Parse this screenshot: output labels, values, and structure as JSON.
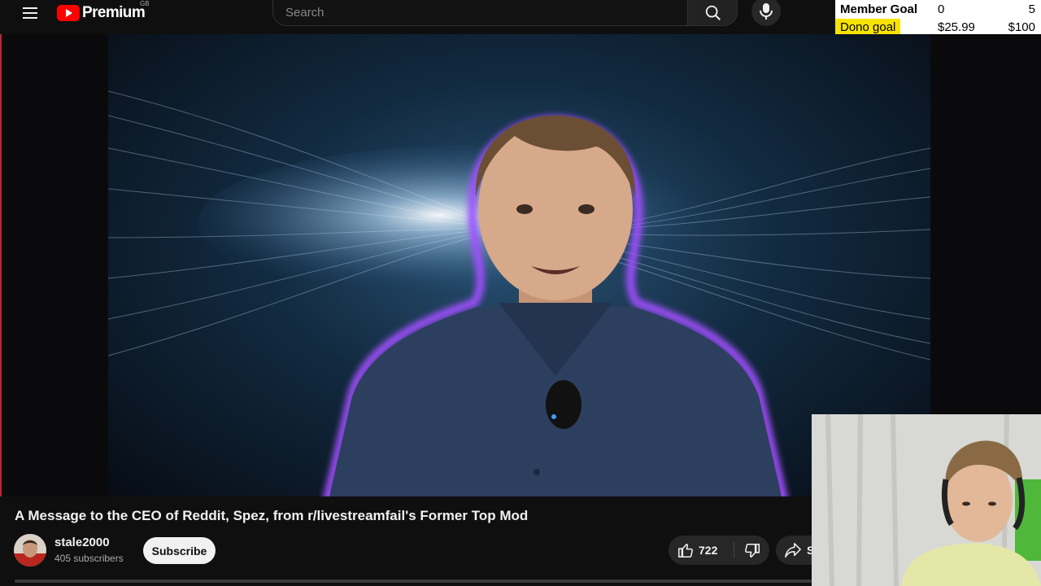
{
  "header": {
    "logo_text": "Premium",
    "region": "GB",
    "search_placeholder": "Search"
  },
  "goals": {
    "member_label": "Member Goal",
    "member_current": "0",
    "member_target": "5",
    "dono_label": "Dono goal",
    "dono_current": "$25.99",
    "dono_target": "$100"
  },
  "video": {
    "title": "A Message to the CEO of Reddit, Spez, from r/livestreamfail's Former Top Mod",
    "channel_name": "stale2000",
    "subscribers": "405 subscribers",
    "subscribe_label": "Subscribe",
    "like_count": "722",
    "share_label": "S"
  },
  "colors": {
    "accent_red": "#ff0000",
    "goal_highlight": "#f6e400",
    "background": "#0f0f0f"
  },
  "icons": [
    "menu-icon",
    "youtube-logo-icon",
    "search-icon",
    "mic-icon",
    "like-icon",
    "dislike-icon",
    "share-icon"
  ]
}
